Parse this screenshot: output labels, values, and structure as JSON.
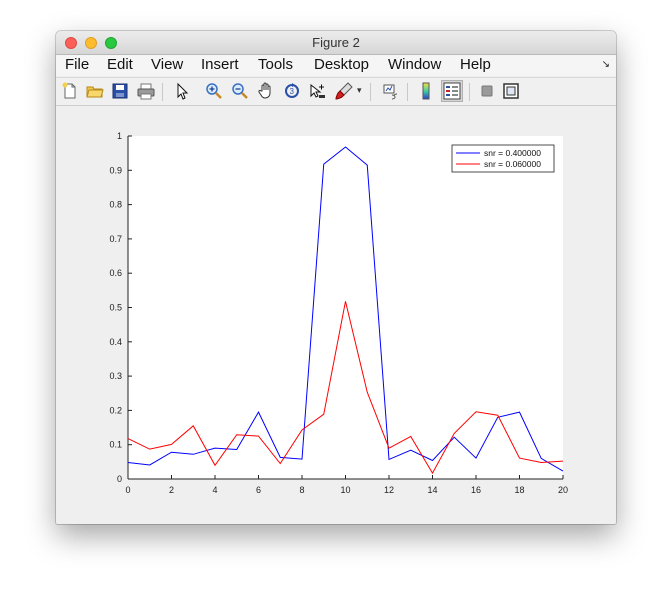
{
  "window": {
    "title": "Figure 2"
  },
  "menubar": {
    "items": [
      "File",
      "Edit",
      "View",
      "Insert",
      "Tools",
      "Desktop",
      "Window",
      "Help"
    ]
  },
  "toolbar": {
    "icons": [
      "new-figure-icon",
      "open-file-icon",
      "save-icon",
      "print-icon",
      "pointer-icon",
      "zoom-in-icon",
      "zoom-out-icon",
      "pan-hand-icon",
      "rotate-3d-icon",
      "data-cursor-icon",
      "brush-icon",
      "link-plot-icon",
      "colorbar-icon",
      "legend-icon",
      "hide-plot-tools-icon",
      "show-plot-tools-icon"
    ]
  },
  "chart_data": {
    "type": "line",
    "title": "",
    "xlabel": "",
    "ylabel": "",
    "xlim": [
      0,
      20
    ],
    "ylim": [
      0,
      1
    ],
    "x_ticks": [
      "0",
      "2",
      "4",
      "6",
      "8",
      "10",
      "12",
      "14",
      "16",
      "18",
      "20"
    ],
    "y_ticks": [
      "0",
      "0.1",
      "0.2",
      "0.3",
      "0.4",
      "0.5",
      "0.6",
      "0.7",
      "0.8",
      "0.9",
      "1"
    ],
    "legend_position": "top-right",
    "x": [
      0,
      1,
      2,
      3,
      4,
      5,
      6,
      7,
      8,
      9,
      10,
      11,
      12,
      13,
      14,
      15,
      16,
      17,
      18,
      19,
      20
    ],
    "series": [
      {
        "name": "snr = 0.400000",
        "color": "#0000ff",
        "values": [
          0.048,
          0.041,
          0.078,
          0.072,
          0.09,
          0.086,
          0.195,
          0.063,
          0.058,
          0.918,
          0.968,
          0.915,
          0.057,
          0.084,
          0.054,
          0.122,
          0.061,
          0.18,
          0.195,
          0.06,
          0.023
        ]
      },
      {
        "name": "snr = 0.060000",
        "color": "#ff0000",
        "values": [
          0.118,
          0.087,
          0.101,
          0.155,
          0.04,
          0.129,
          0.125,
          0.045,
          0.143,
          0.189,
          0.518,
          0.253,
          0.09,
          0.124,
          0.017,
          0.133,
          0.196,
          0.186,
          0.061,
          0.048,
          0.052
        ]
      }
    ]
  }
}
